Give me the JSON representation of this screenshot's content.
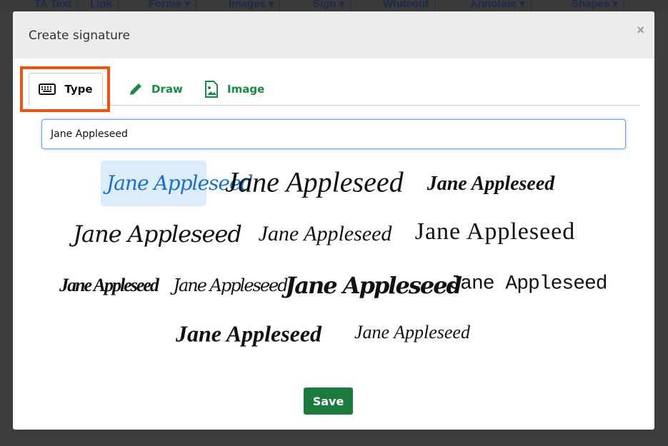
{
  "background": {
    "toolbar": [
      "TA Text",
      "Link",
      "Forms ▾",
      "Images ▾",
      "Sign ▾",
      "Whiteout",
      "Annotate ▾",
      "Shapes ▾"
    ]
  },
  "modal": {
    "title": "Create signature",
    "close": "×",
    "tabs": [
      {
        "label": "Type",
        "icon": "keyboard-icon"
      },
      {
        "label": "Draw",
        "icon": "pencil-icon"
      },
      {
        "label": "Image",
        "icon": "image-icon"
      }
    ],
    "input_value": "Jane Appleseed",
    "signatures": [
      "Jane Appleseed",
      "Jane Appleseed",
      "Jane Appleseed",
      "Jane Appleseed",
      "Jane Appleseed",
      "Jane Appleseed",
      "Jane Appleseed",
      "Jane Appleseed",
      "Jane Appleseed",
      "Jane Appleseed",
      "Jane Appleseed",
      "Jane Appleseed"
    ],
    "save": "Save"
  },
  "colors": {
    "accent": "#1b8a45",
    "highlight": "#f2500f",
    "selected": "#1a6fd1"
  }
}
